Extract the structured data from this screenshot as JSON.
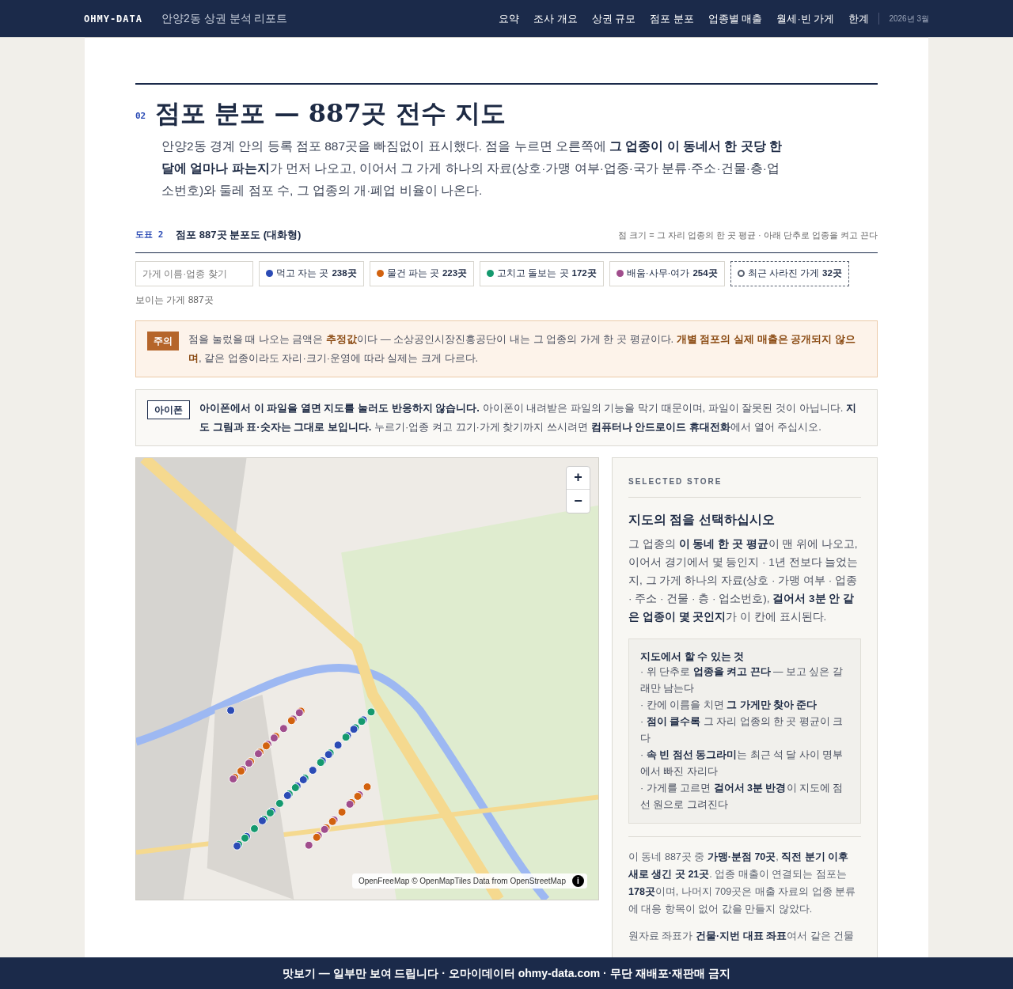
{
  "header": {
    "brand": "OHMY-DATA",
    "report_title": "안양2동 상권 분석 리포트",
    "nav": [
      "요약",
      "조사 개요",
      "상권 규모",
      "점포 분포",
      "업종별 매출",
      "월세·빈 가게",
      "한계"
    ],
    "date": "2026년 3월"
  },
  "section": {
    "number": "02",
    "title": "점포 분포 — 887곳 전수 지도",
    "lead": "안양2동 경계 안의 등록 점포 887곳을 빠짐없이 표시했다. 점을 누르면 오른쪽에 **그 업종이 이 동네서 한 곳당 한 달에 얼마나 파는지**가 먼저 나오고, 이어서 그 가게 하나의 자료(상호·가맹 여부·업종·국가 분류·주소·건물·층·업소번호)와 둘레 점포 수, 그 업종의 개·폐업 비율이 나온다."
  },
  "figure": {
    "label": "도표",
    "number": "2",
    "title": "점포 887곳 분포도 (대화형)",
    "note": "점 크기 = 그 자리 업종의 한 곳 평균 · 아래 단추로 업종을 켜고 끈다"
  },
  "search": {
    "placeholder": "가게 이름·업종 찾기"
  },
  "filters": [
    {
      "kind": "category",
      "label": "먹고 자는 곳",
      "count": "238곳",
      "color": "#2b4bb5",
      "on": true
    },
    {
      "kind": "category",
      "label": "물건 파는 곳",
      "count": "223곳",
      "color": "#d2620f",
      "on": true
    },
    {
      "kind": "category",
      "label": "고치고 돌보는 곳",
      "count": "172곳",
      "color": "#14996e",
      "on": true
    },
    {
      "kind": "category",
      "label": "배움·사무·여가",
      "count": "254곳",
      "color": "#a04d8c",
      "on": true
    },
    {
      "kind": "closed",
      "label": "최근 사라진 가게",
      "count": "32곳",
      "color": "#5a6270",
      "on": true
    }
  ],
  "visible_count": "보이는 가게 887곳",
  "notices": [
    {
      "kind": "caution",
      "badge": "주의",
      "text": "점을 눌렀을 때 나오는 금액은 **추정값**이다 — 소상공인시장진흥공단이 내는 그 업종의 가게 한 곳 평균이다. **개별 점포의 실제 매출은 공개되지 않으며**, 같은 업종이라도 자리·크기·운영에 따라 실제는 크게 다르다."
    },
    {
      "kind": "info",
      "badge": "아이폰",
      "text": "**아이폰에서 이 파일을 열면 지도를 눌러도 반응하지 않습니다.** 아이폰이 내려받은 파일의 기능을 막기 때문이며, 파일이 잘못된 것이 아닙니다. **지도 그림과 표·숫자는 그대로 보입니다.** 누르기·업종 켜고 끄기·가게 찾기까지 쓰시려면 **컴퓨터나 안드로이드 휴대전화**에서 열어 주십시오."
    }
  ],
  "map": {
    "zoom_in": "+",
    "zoom_out": "−",
    "attribution": "OpenFreeMap © OpenMapTiles Data from OpenStreetMap",
    "info": "i"
  },
  "panel": {
    "eyebrow": "SELECTED STORE",
    "heading": "지도의 점을 선택하십시오",
    "intro": "그 업종의 **이 동네 한 곳 평균**이 맨 위에 나오고, 이어서 경기에서 몇 등인지 · 1년 전보다 늘었는지, 그 가게 하나의 자료(상호 · 가맹 여부 · 업종 · 주소 · 건물 · 층 · 업소번호), **걸어서 3분 안 같은 업종이 몇 곳인지**가 이 칸에 표시된다.",
    "howto_title": "지도에서 할 수 있는 것",
    "howto": [
      "· 위 단추로 **업종을 켜고 끈다** — 보고 싶은 갈래만 남는다",
      "· 칸에 이름을 치면 **그 가게만 찾아 준다**",
      "· **점이 클수록** 그 자리 업종의 한 곳 평균이 크다",
      "· **속 빈 점선 동그라미**는 최근 석 달 사이 명부에서 빠진 자리다",
      "· 가게를 고르면 **걸어서 3분 반경**이 지도에 점선 원으로 그려진다"
    ],
    "notes": [
      "이 동네 887곳 중 **가맹·분점 70곳**, **직전 분기 이후 새로 생긴 곳 21곳**. 업종 매출이 연결되는 점포는 **178곳**이며, 나머지 709곳은 매출 자료의 업종 분류에 대응 항목이 없어 값을 만들지 않았다.",
      "원자료 좌표가 **건물·지번 대표 좌표**여서 같은 건물"
    ]
  },
  "footer": "맛보기 — 일부만 보여 드립니다 · 오마이데이터 ohmy-data.com · 무단 재배포·재판매 금지"
}
